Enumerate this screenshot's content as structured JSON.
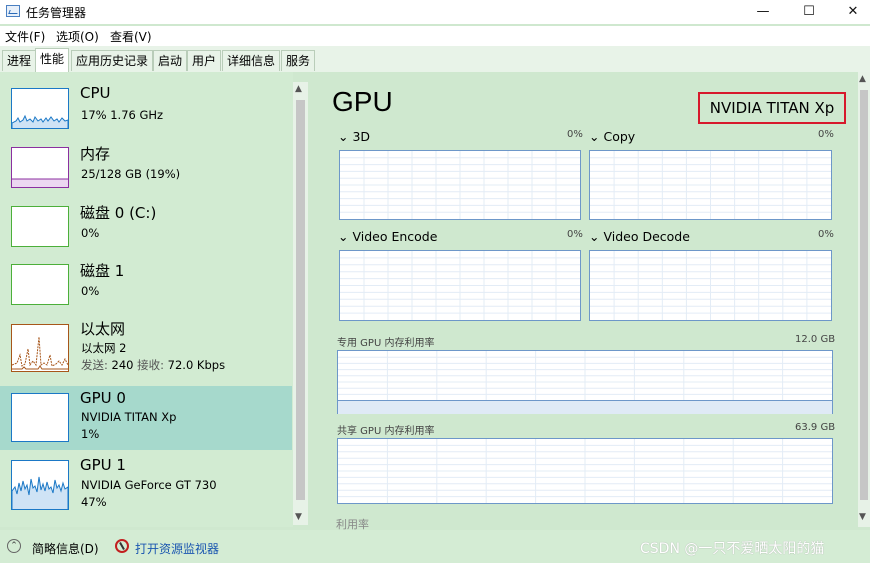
{
  "window": {
    "title": "任务管理器",
    "minimize": "—",
    "maximize": "☐",
    "close": "✕"
  },
  "menu": {
    "file": "文件(F)",
    "options": "选项(O)",
    "view": "查看(V)"
  },
  "tabs": [
    "进程",
    "性能",
    "应用历史记录",
    "启动",
    "用户",
    "详细信息",
    "服务"
  ],
  "sidebar": {
    "items": [
      {
        "title": "CPU",
        "line1": "17% 1.76 GHz",
        "line2": ""
      },
      {
        "title": "内存",
        "line1": "25/128 GB (19%)",
        "line2": ""
      },
      {
        "title": "磁盘 0 (C:)",
        "line1": "0%",
        "line2": ""
      },
      {
        "title": "磁盘 1",
        "line1": "0%",
        "line2": ""
      },
      {
        "title": "以太网",
        "line1": "以太网 2",
        "line2_label_send": "发送:",
        "line2_send": "240",
        "line2_label_recv": "接收:",
        "line2_recv": "72.0 Kbps"
      },
      {
        "title": "GPU 0",
        "line1": "NVIDIA TITAN Xp",
        "line2": "1%"
      },
      {
        "title": "GPU 1",
        "line1": "NVIDIA GeForce GT 730",
        "line2": "47%"
      }
    ]
  },
  "main": {
    "title": "GPU",
    "gpu_name": "NVIDIA TITAN Xp",
    "engines": [
      {
        "name": "3D",
        "pct": "0%"
      },
      {
        "name": "Copy",
        "pct": "0%"
      },
      {
        "name": "Video Encode",
        "pct": "0%"
      },
      {
        "name": "Video Decode",
        "pct": "0%"
      }
    ],
    "dedicated_label": "专用 GPU 内存利用率",
    "dedicated_max": "12.0 GB",
    "shared_label": "共享 GPU 内存利用率",
    "shared_max": "63.9 GB",
    "cutoff_text": "利用率"
  },
  "footer": {
    "fewer_details": "简略信息(D)",
    "open_monitor": "打开资源监视器"
  },
  "watermark": "CSDN @一只不爱晒太阳的猫",
  "colors": {
    "cpu": "#1b78c6",
    "memory": "#8b2fa0",
    "disk": "#4caf3a",
    "ethernet": "#a7561a",
    "gpu": "#1b78c6",
    "highlight": "#d7192c"
  }
}
